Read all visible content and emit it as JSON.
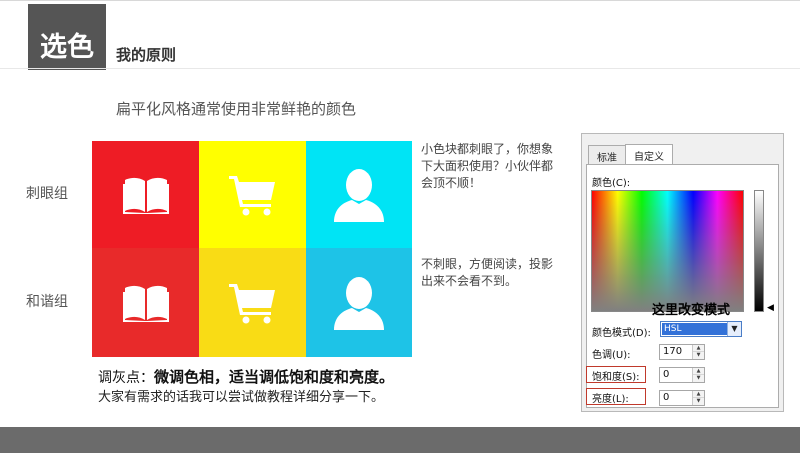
{
  "header": {
    "title": "选色",
    "subtitle": "我的原则"
  },
  "headline": "扁平化风格通常使用非常鲜艳的颜色",
  "rows": {
    "vivid_label": "刺眼组",
    "harmonious_label": "和谐组"
  },
  "colors": {
    "vivid": [
      "#ee1c25",
      "#ffff00",
      "#00e4f5"
    ],
    "harmonious": [
      "#e82a2a",
      "#f9dc15",
      "#1ec3e7"
    ],
    "icon": "#ffffff"
  },
  "icons": [
    "book-icon",
    "shopping-cart-icon",
    "person-icon"
  ],
  "notes": {
    "vivid": "小色块都刺眼了，你想象下大面积使用？小伙伴都会顶不顺！",
    "harmonious": "不刺眼，方便阅读，投影出来不会看不到。"
  },
  "tips": {
    "prefix": "调灰点：",
    "bold": "微调色相，适当调低饱和度和亮度。",
    "line2": "大家有需求的话我可以尝试做教程详细分享一下。"
  },
  "dialog": {
    "tabs": [
      "标准",
      "自定义"
    ],
    "active_tab": "自定义",
    "colors_label": "颜色(C):",
    "mode_label": "颜色模式(D):",
    "mode_value": "HSL",
    "hue_label": "色调(U):",
    "hue_value": "170",
    "sat_label": "饱和度(S):",
    "sat_value": "0",
    "lum_label": "亮度(L):",
    "lum_value": "0",
    "callout": "这里改变模式"
  }
}
